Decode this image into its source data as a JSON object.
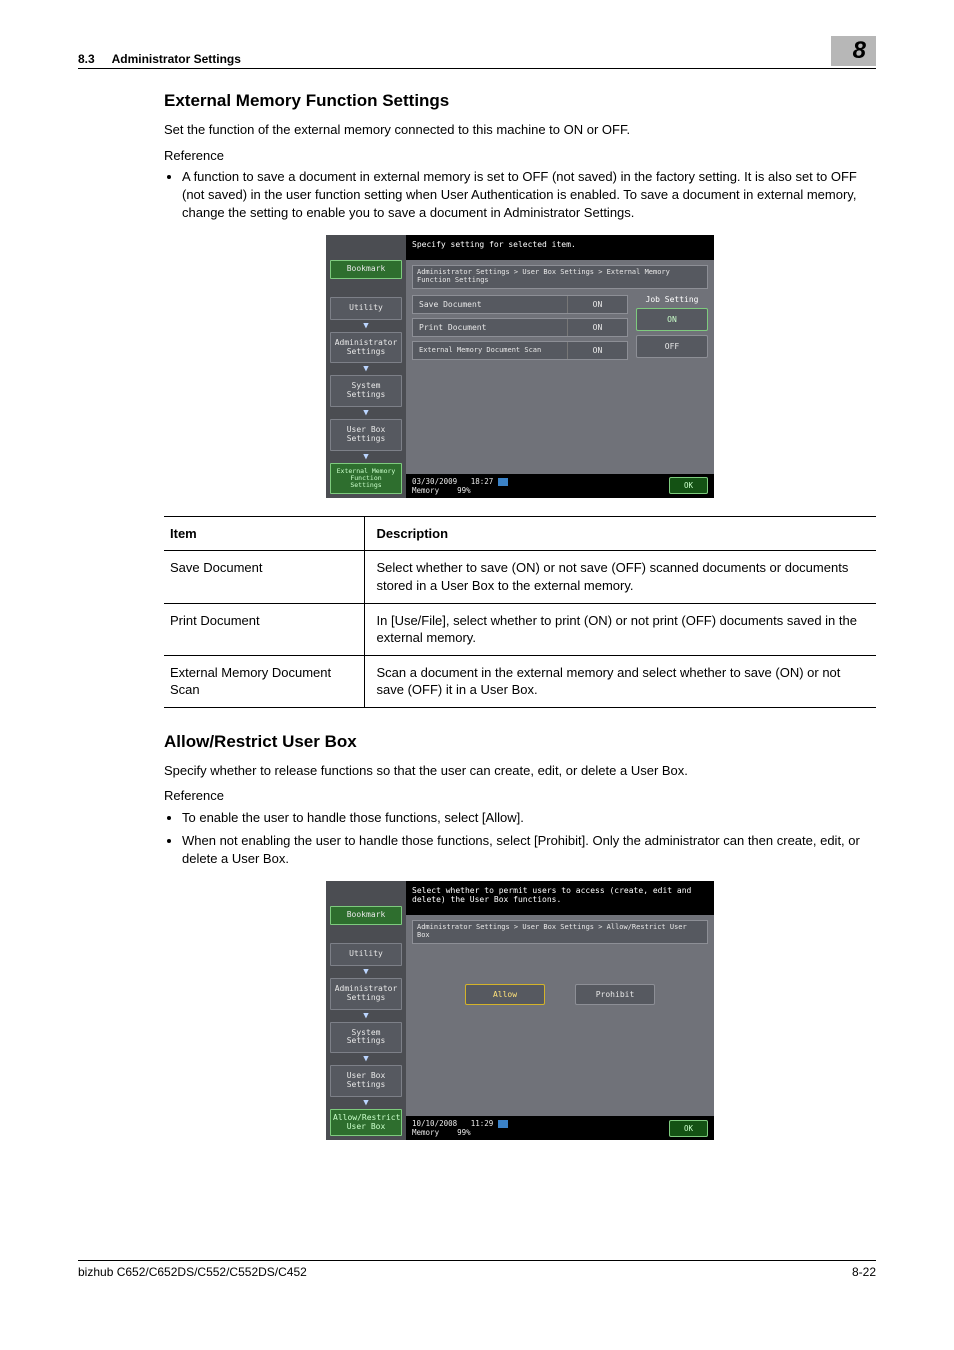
{
  "header": {
    "section_number": "8.3",
    "section_title": "Administrator Settings",
    "chapter": "8"
  },
  "section1": {
    "title": "External Memory Function Settings",
    "intro": "Set the function of the external memory connected to this machine to ON or OFF.",
    "reference_label": "Reference",
    "bullet1": "A function to save a document in external memory is set to OFF (not saved) in the factory setting. It is also set to OFF (not saved) in the user function setting when User Authentication is enabled. To save a document in external memory, change the setting to enable you to save a document in Administrator Settings."
  },
  "screenshot1": {
    "title": "Specify setting for selected item.",
    "breadcrumb": "Administrator Settings > User Box Settings > External Memory Function Settings",
    "sidebar": {
      "bookmark": "Bookmark",
      "utility": "Utility",
      "admin": "Administrator Settings",
      "system": "System Settings",
      "userbox": "User Box Settings",
      "ext": "External Memory Function Settings"
    },
    "rows": [
      {
        "label": "Save Document",
        "value": "ON"
      },
      {
        "label": "Print Document",
        "value": "ON"
      },
      {
        "label": "External Memory Document Scan",
        "value": "ON"
      }
    ],
    "job_setting_label": "Job Setting",
    "job_on": "ON",
    "job_off": "OFF",
    "footer": {
      "date": "03/30/2009",
      "time": "18:27",
      "mem_label": "Memory",
      "mem_pct": "99%",
      "ok": "OK"
    }
  },
  "table1": {
    "head_item": "Item",
    "head_desc": "Description",
    "rows": [
      {
        "item": "Save Document",
        "desc": "Select whether to save (ON) or not save (OFF) scanned documents or documents stored in a User Box to the external memory."
      },
      {
        "item": "Print Document",
        "desc": "In [Use/File], select whether to print (ON) or not print (OFF) documents saved in the external memory."
      },
      {
        "item": "External Memory Document Scan",
        "desc": "Scan a document in the external memory and select whether to save (ON) or not save (OFF) it in a User Box."
      }
    ]
  },
  "section2": {
    "title": "Allow/Restrict User Box",
    "intro": "Specify whether to release functions so that the user can create, edit, or delete a User Box.",
    "reference_label": "Reference",
    "bullet1": "To enable the user to handle those functions, select [Allow].",
    "bullet2": "When not enabling the user to handle those functions, select [Prohibit]. Only the administrator can then create, edit, or delete a User Box."
  },
  "screenshot2": {
    "title": "Select whether to permit users to access (create, edit and delete) the User Box functions.",
    "breadcrumb": "Administrator Settings > User Box Settings > Allow/Restrict User Box",
    "sidebar": {
      "bookmark": "Bookmark",
      "utility": "Utility",
      "admin": "Administrator Settings",
      "system": "System Settings",
      "userbox": "User Box Settings",
      "allow": "Allow/Restrict User Box"
    },
    "allow": "Allow",
    "prohibit": "Prohibit",
    "footer": {
      "date": "10/10/2008",
      "time": "11:29",
      "mem_label": "Memory",
      "mem_pct": "99%",
      "ok": "OK"
    }
  },
  "footer": {
    "model": "bizhub C652/C652DS/C552/C552DS/C452",
    "page": "8-22"
  }
}
